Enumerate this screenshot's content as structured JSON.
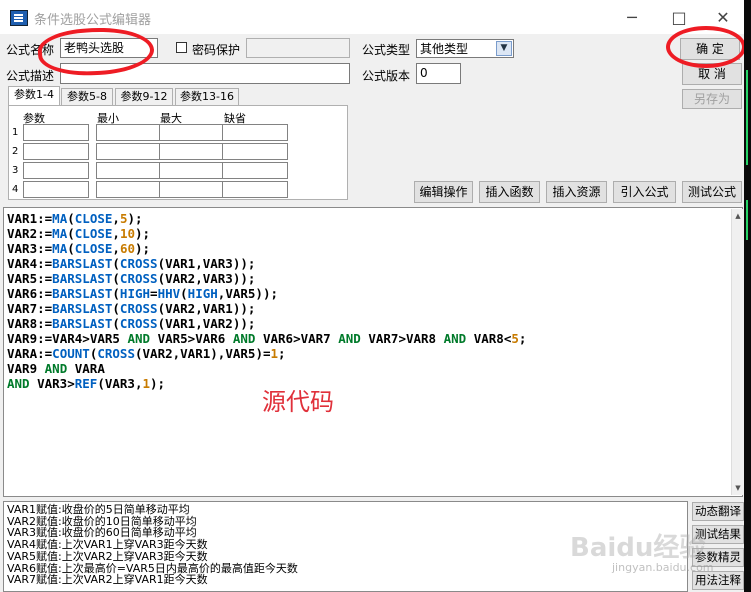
{
  "window": {
    "title": "条件选股公式编辑器",
    "minimize": "─",
    "maximize": "□",
    "close": "✕"
  },
  "form": {
    "name_label": "公式名称",
    "name_value": "老鸭头选股",
    "password_label": "密码保护",
    "type_label": "公式类型",
    "type_value": "其他类型",
    "desc_label": "公式描述",
    "desc_value": "",
    "version_label": "公式版本",
    "version_value": "0"
  },
  "buttons": {
    "ok": "确  定",
    "cancel": "取  消",
    "save_as": "另存为"
  },
  "param_tabs": [
    "参数1-4",
    "参数5-8",
    "参数9-12",
    "参数13-16"
  ],
  "param_table": {
    "headers": [
      "参数",
      "最小",
      "最大",
      "缺省"
    ],
    "rows": [
      "1",
      "2",
      "3",
      "4"
    ]
  },
  "toolbar": [
    "编辑操作",
    "插入函数",
    "插入资源",
    "引入公式",
    "测试公式"
  ],
  "code_lines": [
    "VAR1:=MA(CLOSE,5);",
    "VAR2:=MA(CLOSE,10);",
    "VAR3:=MA(CLOSE,60);",
    "VAR4:=BARSLAST(CROSS(VAR1,VAR3));",
    "VAR5:=BARSLAST(CROSS(VAR2,VAR3));",
    "VAR6:=BARSLAST(HIGH=HHV(HIGH,VAR5));",
    "VAR7:=BARSLAST(CROSS(VAR2,VAR1));",
    "VAR8:=BARSLAST(CROSS(VAR1,VAR2));",
    "VAR9:=VAR4>VAR5 AND VAR5>VAR6 AND VAR6>VAR7 AND VAR7>VAR8 AND VAR8<5;",
    "VARA:=COUNT(CROSS(VAR2,VAR1),VAR5)=1;",
    "VAR9 AND VARA",
    "AND VAR3>REF(VAR3,1);"
  ],
  "annotation": "源代码",
  "description_lines": [
    "VAR1赋值:收盘价的5日简单移动平均",
    "VAR2赋值:收盘价的10日简单移动平均",
    "VAR3赋值:收盘价的60日简单移动平均",
    "VAR4赋值:上次VAR1上穿VAR3距今天数",
    "VAR5赋值:上次VAR2上穿VAR3距今天数",
    "VAR6赋值:上次最高价=VAR5日内最高价的最高值距今天数",
    "VAR7赋值:上次VAR2上穿VAR1距今天数"
  ],
  "side_buttons": [
    "动态翻译",
    "测试结果",
    "参数精灵",
    "用法注释"
  ],
  "watermark": {
    "main": "Baidu经验",
    "sub": "jingyan.baidu.com"
  },
  "colors": {
    "function": "#0060c0",
    "number": "#c87b00",
    "keyword": "#007a2a",
    "annotation": "#e0303a",
    "highlight_circle": "#ee1c24"
  }
}
